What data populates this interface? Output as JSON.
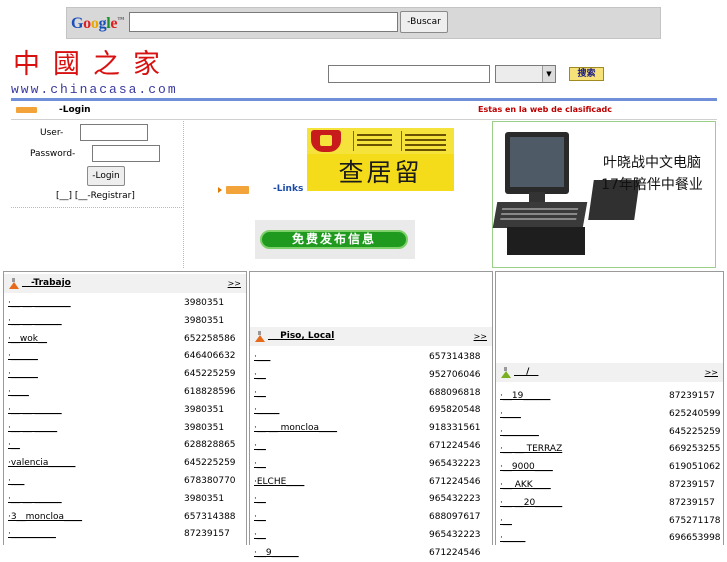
{
  "google": {
    "logo_parts": [
      "G",
      "o",
      "o",
      "g",
      "l",
      "e"
    ],
    "logo_tm": "™",
    "search_value": "",
    "search_button": "-Buscar"
  },
  "logo": {
    "chinese": "中國之家",
    "url": "www.chinacasa.com"
  },
  "site_search": {
    "value": "",
    "category": "",
    "button": "搜索"
  },
  "login_strip": {
    "title": "-Login",
    "notice": "Estas en la web de clasificadc"
  },
  "login": {
    "user_label": "User-",
    "password_label": "Password-",
    "user_value": "",
    "password_value": "",
    "button": "-Login",
    "register": "[__] [__-Registrar]"
  },
  "middle": {
    "banner_text": "查居留",
    "links_label": "-Links",
    "publish_button": "免费发布信息"
  },
  "ad": {
    "line1": "叶晓战中文电脑",
    "line2": "17年陪伴中餐业"
  },
  "colors": {
    "blue_bar": "#6f8fd8",
    "notice_red": "#c00000",
    "badge_orange": "#f2a33a"
  },
  "columns": [
    {
      "title": "__-Trabajo",
      "more": ">>",
      "rows": [
        {
          "t": "·__ __ ________",
          "p": "3980351"
        },
        {
          "t": "·__ __ ______",
          "p": "3980351"
        },
        {
          "t": "·__wok__",
          "p": "652258586"
        },
        {
          "t": "·______",
          "p": "646406632"
        },
        {
          "t": "·______",
          "p": "645225259"
        },
        {
          "t": "·____",
          "p": "618828596"
        },
        {
          "t": "·__ __ ______",
          "p": "3980351"
        },
        {
          "t": "·__ __ _____",
          "p": "3980351"
        },
        {
          "t": "·__",
          "p": "628828865"
        },
        {
          "t": "·valencia______",
          "p": "645225259"
        },
        {
          "t": "·___",
          "p": "678380770"
        },
        {
          "t": "·__ __ ______",
          "p": "3980351"
        },
        {
          "t": "·3__moncloa____",
          "p": "657314388"
        },
        {
          "t": "·__________",
          "p": "87239157"
        }
      ]
    },
    {
      "title": "__ Piso, Local",
      "more": ">>",
      "rows": [
        {
          "t": "·___",
          "p": "657314388"
        },
        {
          "t": "·__",
          "p": "952706046"
        },
        {
          "t": "·__",
          "p": "688096818"
        },
        {
          "t": "·_____",
          "p": "695820548"
        },
        {
          "t": "·__ __ moncloa____",
          "p": "918331561"
        },
        {
          "t": "·__",
          "p": "671224546"
        },
        {
          "t": "·__",
          "p": "965432223"
        },
        {
          "t": "·ELCHE____",
          "p": "671224546"
        },
        {
          "t": "·__",
          "p": "965432223"
        },
        {
          "t": "·__",
          "p": "688097617"
        },
        {
          "t": "·__",
          "p": "965432223"
        },
        {
          "t": "·__9______",
          "p": "671224546"
        }
      ]
    },
    {
      "title": "__ /__",
      "more": ">>",
      "rows": [
        {
          "t": "·__19______",
          "p": "87239157"
        },
        {
          "t": "·____",
          "p": "625240599"
        },
        {
          "t": "·________",
          "p": "645225259"
        },
        {
          "t": "·__ __ TERRAZ",
          "p": "669253255"
        },
        {
          "t": "·__9000____",
          "p": "619051062"
        },
        {
          "t": "·__ AKK____",
          "p": "87239157"
        },
        {
          "t": "·__ __20______",
          "p": "87239157"
        },
        {
          "t": "·__",
          "p": "675271178"
        },
        {
          "t": "·_____",
          "p": "696653998"
        }
      ]
    }
  ]
}
